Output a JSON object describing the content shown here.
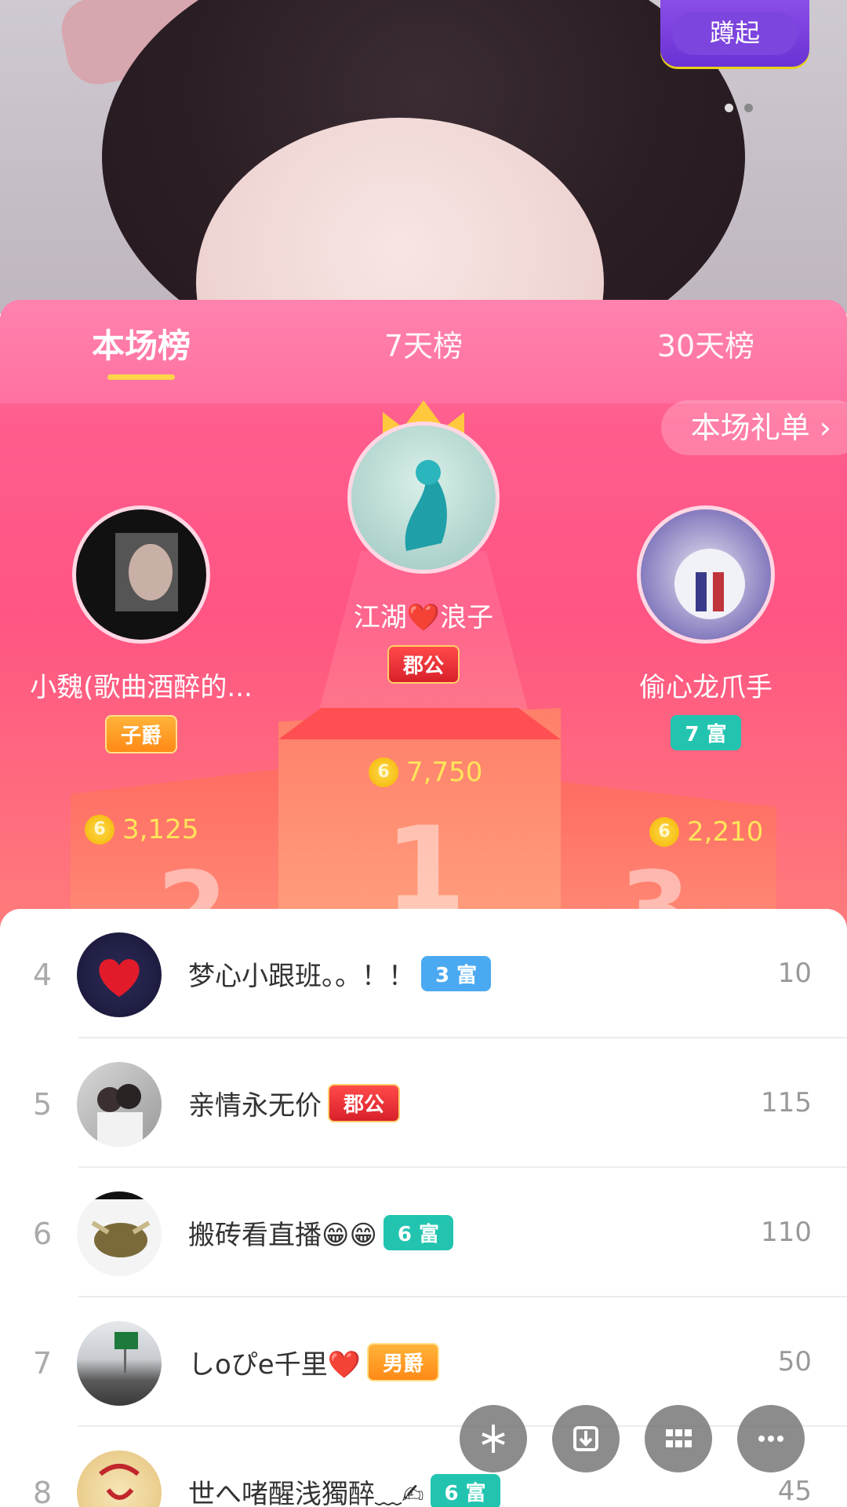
{
  "banner": {
    "squat_button": "蹲起"
  },
  "tabs": [
    {
      "label": "本场榜",
      "active": true
    },
    {
      "label": "7天榜",
      "active": false
    },
    {
      "label": "30天榜",
      "active": false
    }
  ],
  "gift_list_button": "本场礼单",
  "podium": {
    "first": {
      "name": "江湖❤️浪子",
      "badge": "郡公",
      "coins": "7,750",
      "place": "1"
    },
    "second": {
      "name": "小魏(歌曲酒醉的...",
      "badge": "子爵",
      "coins": "3,125",
      "place": "2"
    },
    "third": {
      "name": "偷心龙爪手",
      "badge": "7 富",
      "coins": "2,210",
      "place": "3"
    }
  },
  "coin_glyph": "6",
  "list": [
    {
      "rank": "4",
      "name": "梦心小跟班。。！！",
      "badge": "3 富",
      "badge_color": "#4aa9f0",
      "score": "10"
    },
    {
      "rank": "5",
      "name": "亲情永无价",
      "badge": "郡公",
      "badge_color": "#d8202a",
      "score": "115"
    },
    {
      "rank": "6",
      "name": "搬砖看直播😁😁",
      "badge": "6 富",
      "badge_color": "#22c4b0",
      "score": "110"
    },
    {
      "rank": "7",
      "name": "しoぴe千里❤️",
      "badge": "男爵",
      "badge_color": "#ff8a16",
      "score": "50"
    },
    {
      "rank": "8",
      "name": "世へ啫醒浅獨醉﹏✍",
      "badge": "6 富",
      "badge_color": "#22c4b0",
      "score": "45"
    }
  ],
  "floating_icons": [
    "sparkle-icon",
    "download-icon",
    "grid-icon",
    "more-icon"
  ]
}
